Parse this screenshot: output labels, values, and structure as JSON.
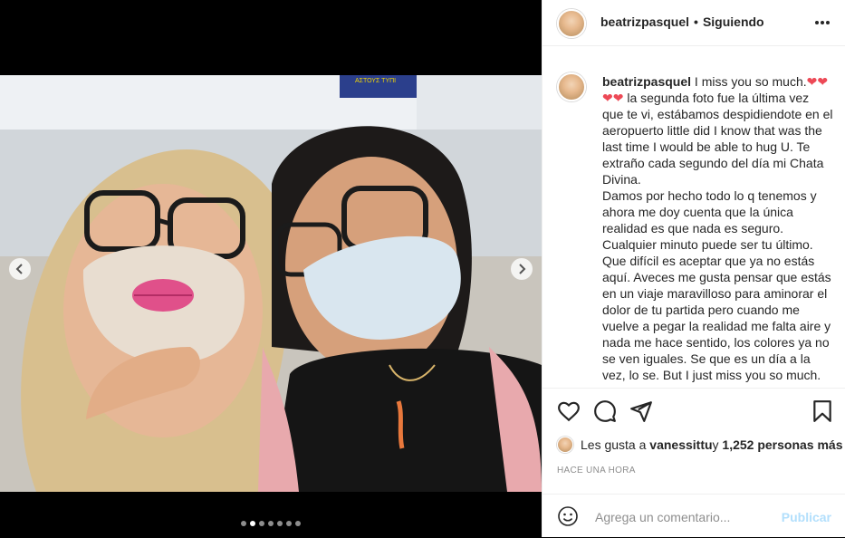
{
  "post": {
    "username": "beatrizpasquel",
    "separator": "•",
    "follow_status": "Siguiendo",
    "caption_user": "beatrizpasquel",
    "caption_start": "I miss you so much.",
    "caption_hearts": "❤❤",
    "caption_hearts2": "❤❤",
    "caption_body": " la segunda foto fue la última vez que te vi, estábamos despidiendote en el aeropuerto little did I know that was the last time I would be able to hug U. Te extraño cada segundo del día mi Chata Divina.\nDamos por hecho todo lo q tenemos y ahora me doy cuenta que la única realidad es que nada es seguro. Cualquier minuto puede ser tu último. Que difícil es aceptar que ya no estás aquí. Aveces me gusta pensar que estás en un viaje maravilloso para aminorar el dolor de tu partida pero cuando me vuelve a pegar la realidad me falta aire y nada me hace sentido, los colores ya no se ven iguales. Se que es un día a la vez, lo se. But I just miss you so much.",
    "likes_prefix": "Les gusta a ",
    "likes_user": "vanessittu",
    "likes_mid": " y ",
    "likes_count": "1,252 personas más",
    "time_ago": "HACE UNA HORA",
    "carousel": {
      "count": 7,
      "active_index": 1
    }
  },
  "comment": {
    "placeholder": "Agrega un comentario...",
    "post_label": "Publicar"
  },
  "photo_sign": "ΑΣΤΟΥΣ ΤΥΠΙ",
  "colors": {
    "border": "#efefef",
    "text": "#262626",
    "muted": "#8e8e8e",
    "heart": "#ed4956",
    "post_disabled": "#b2dffc"
  },
  "icons": [
    "heart-icon",
    "comment-icon",
    "share-icon",
    "bookmark-icon",
    "more-options-icon",
    "chevron-left-icon",
    "chevron-right-icon",
    "emoji-icon"
  ]
}
